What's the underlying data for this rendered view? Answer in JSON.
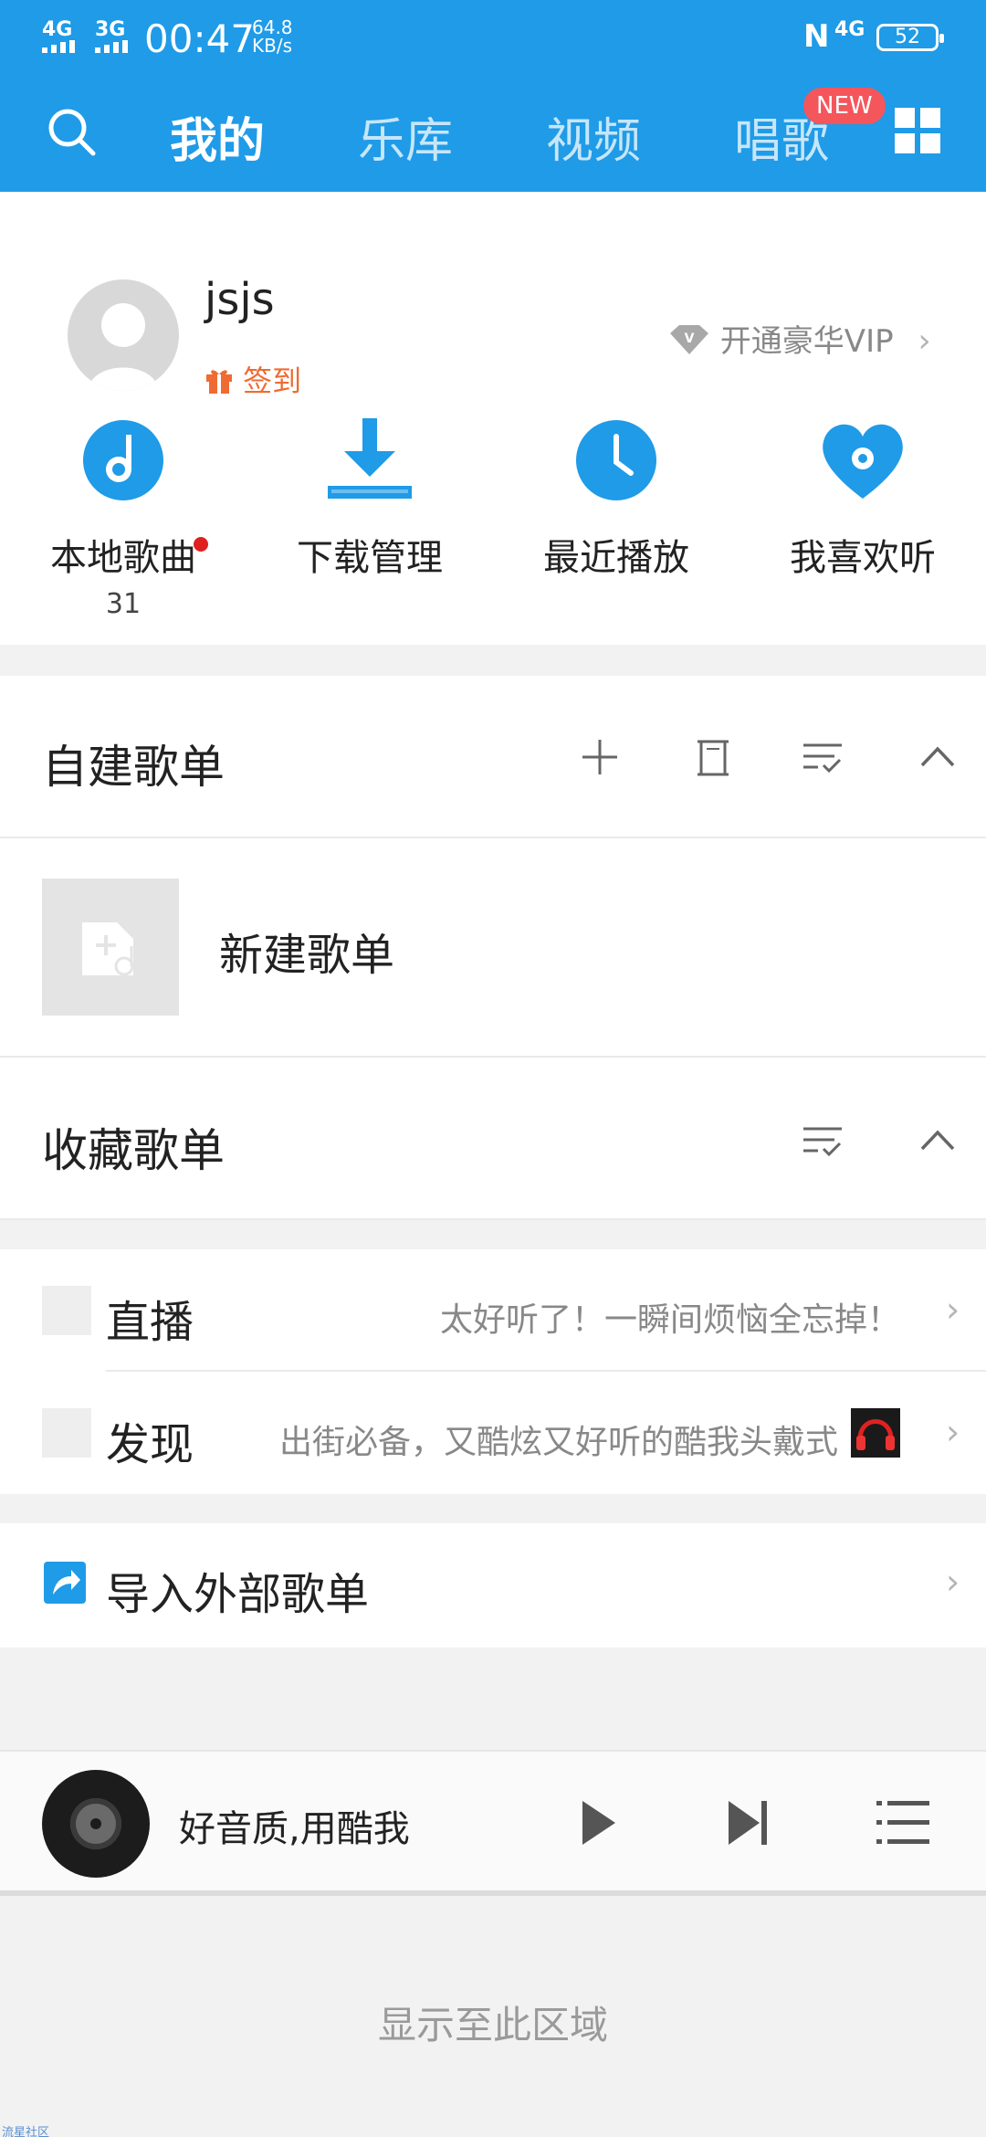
{
  "status_bar": {
    "signal1": "4G",
    "signal2": "3G",
    "time": "00:47",
    "speed_value": "64.8",
    "speed_unit": "KB/s",
    "nfc": "N",
    "network": "4G",
    "battery": "52"
  },
  "top_nav": {
    "tabs": [
      {
        "label": "我的",
        "active": true
      },
      {
        "label": "乐库",
        "active": false
      },
      {
        "label": "视频",
        "active": false
      },
      {
        "label": "唱歌",
        "active": false
      }
    ],
    "new_badge": "NEW",
    "accent_color": "#1f9be8"
  },
  "profile": {
    "username": "jsjs",
    "checkin_label": "签到",
    "vip_label": "开通豪华VIP"
  },
  "quick_actions": [
    {
      "label": "本地歌曲",
      "count": "31",
      "icon": "music-note-icon"
    },
    {
      "label": "下载管理",
      "icon": "download-icon"
    },
    {
      "label": "最近播放",
      "icon": "clock-icon"
    },
    {
      "label": "我喜欢听",
      "icon": "heart-icon"
    }
  ],
  "custom_playlists": {
    "title": "自建歌单",
    "new_playlist_label": "新建歌单"
  },
  "favorite_playlists": {
    "title": "收藏歌单"
  },
  "rows": [
    {
      "title": "直播",
      "desc": "太好听了！一瞬间烦恼全忘掉！"
    },
    {
      "title": "发现",
      "desc": "出街必备，又酷炫又好听的酷我头戴式"
    }
  ],
  "import": {
    "label": "导入外部歌单"
  },
  "player": {
    "song": "好音质,用酷我"
  },
  "display_area_text": "显示至此区域",
  "watermark": "流星社区"
}
